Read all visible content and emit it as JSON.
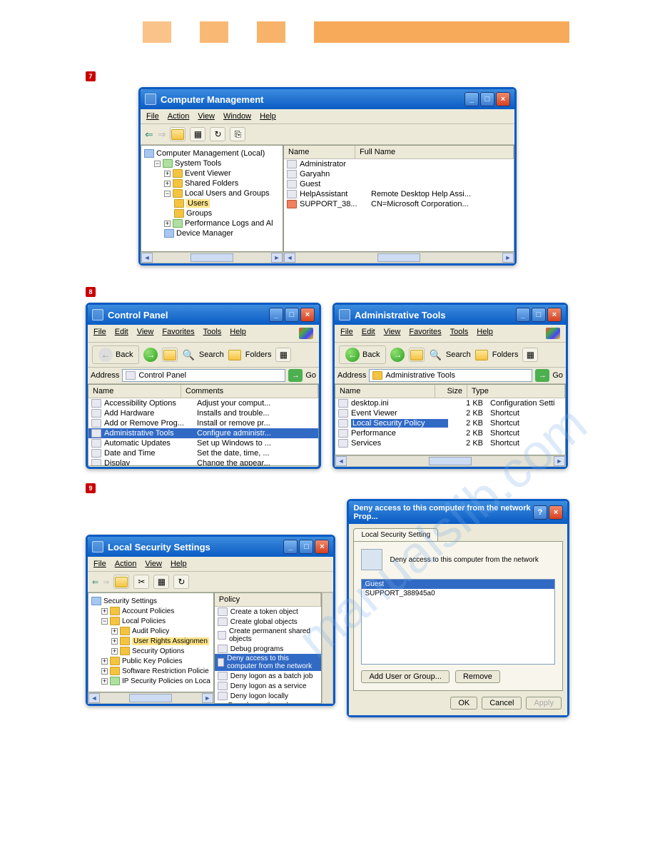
{
  "watermark": "manualslib.com",
  "steps": {
    "s7": "7",
    "s8": "8",
    "s9": "9"
  },
  "cm": {
    "title": "Computer Management",
    "menus": {
      "file": "File",
      "action": "Action",
      "view": "View",
      "window": "Window",
      "help": "Help"
    },
    "tree": {
      "root": "Computer Management (Local)",
      "systools": "System Tools",
      "ev": "Event Viewer",
      "sf": "Shared Folders",
      "lug": "Local Users and Groups",
      "users": "Users",
      "groups": "Groups",
      "perf": "Performance Logs and Al",
      "dev": "Device Manager"
    },
    "cols": {
      "name": "Name",
      "full": "Full Name"
    },
    "users": {
      "admin": "Administrator",
      "gary": "Garyahn",
      "guest": "Guest",
      "help": "HelpAssistant",
      "help_full": "Remote Desktop Help Assi...",
      "support": "SUPPORT_38...",
      "support_full": "CN=Microsoft Corporation..."
    }
  },
  "cp": {
    "title": "Control Panel",
    "menus": {
      "file": "File",
      "edit": "Edit",
      "view": "View",
      "fav": "Favorites",
      "tools": "Tools",
      "help": "Help"
    },
    "back": "Back",
    "search": "Search",
    "folders": "Folders",
    "addr_label": "Address",
    "addr_value": "Control Panel",
    "go": "Go",
    "cols": {
      "name": "Name",
      "comments": "Comments"
    },
    "items": [
      {
        "name": "Accessibility Options",
        "c": "Adjust your comput..."
      },
      {
        "name": "Add Hardware",
        "c": "Installs and trouble..."
      },
      {
        "name": "Add or Remove Prog...",
        "c": "Install or remove pr..."
      },
      {
        "name": "Administrative Tools",
        "c": "Configure administr...",
        "sel": true
      },
      {
        "name": "Automatic Updates",
        "c": "Set up Windows to ..."
      },
      {
        "name": "Date and Time",
        "c": "Set the date, time, ..."
      },
      {
        "name": "Display",
        "c": "Change the appear..."
      }
    ]
  },
  "at": {
    "title": "Administrative Tools",
    "menus": {
      "file": "File",
      "edit": "Edit",
      "view": "View",
      "fav": "Favorites",
      "tools": "Tools",
      "help": "Help"
    },
    "back": "Back",
    "search": "Search",
    "folders": "Folders",
    "addr_label": "Address",
    "addr_value": "Administrative Tools",
    "go": "Go",
    "cols": {
      "name": "Name",
      "size": "Size",
      "type": "Type"
    },
    "items": [
      {
        "name": "desktop.ini",
        "size": "1 KB",
        "type": "Configuration Setti"
      },
      {
        "name": "Event Viewer",
        "size": "2 KB",
        "type": "Shortcut"
      },
      {
        "name": "Local Security Policy",
        "size": "2 KB",
        "type": "Shortcut",
        "sel": true
      },
      {
        "name": "Performance",
        "size": "2 KB",
        "type": "Shortcut"
      },
      {
        "name": "Services",
        "size": "2 KB",
        "type": "Shortcut"
      }
    ]
  },
  "lss": {
    "title": "Local Security Settings",
    "menus": {
      "file": "File",
      "action": "Action",
      "view": "View",
      "help": "Help"
    },
    "tree": {
      "root": "Security Settings",
      "acct": "Account Policies",
      "local": "Local Policies",
      "audit": "Audit Policy",
      "ura": "User Rights Assignmen",
      "secopt": "Security Options",
      "pk": "Public Key Policies",
      "srp": "Software Restriction Policie",
      "ipsec": "IP Security Policies on Loca"
    },
    "col": "Policy",
    "policies": [
      "Create a token object",
      "Create global objects",
      "Create permanent shared objects",
      "Debug programs",
      "Deny access to this computer from the network",
      "Deny logon as a batch job",
      "Deny logon as a service",
      "Deny logon locally",
      "Deny logon through Terminal Services"
    ],
    "sel_idx": 4
  },
  "deny": {
    "title": "Deny access to this computer from the network Prop...",
    "tab": "Local Security Setting",
    "desc": "Deny access to this computer from the network",
    "list": [
      "Guest",
      "SUPPORT_388945a0"
    ],
    "add": "Add User or Group...",
    "remove": "Remove",
    "ok": "OK",
    "cancel": "Cancel",
    "apply": "Apply"
  }
}
